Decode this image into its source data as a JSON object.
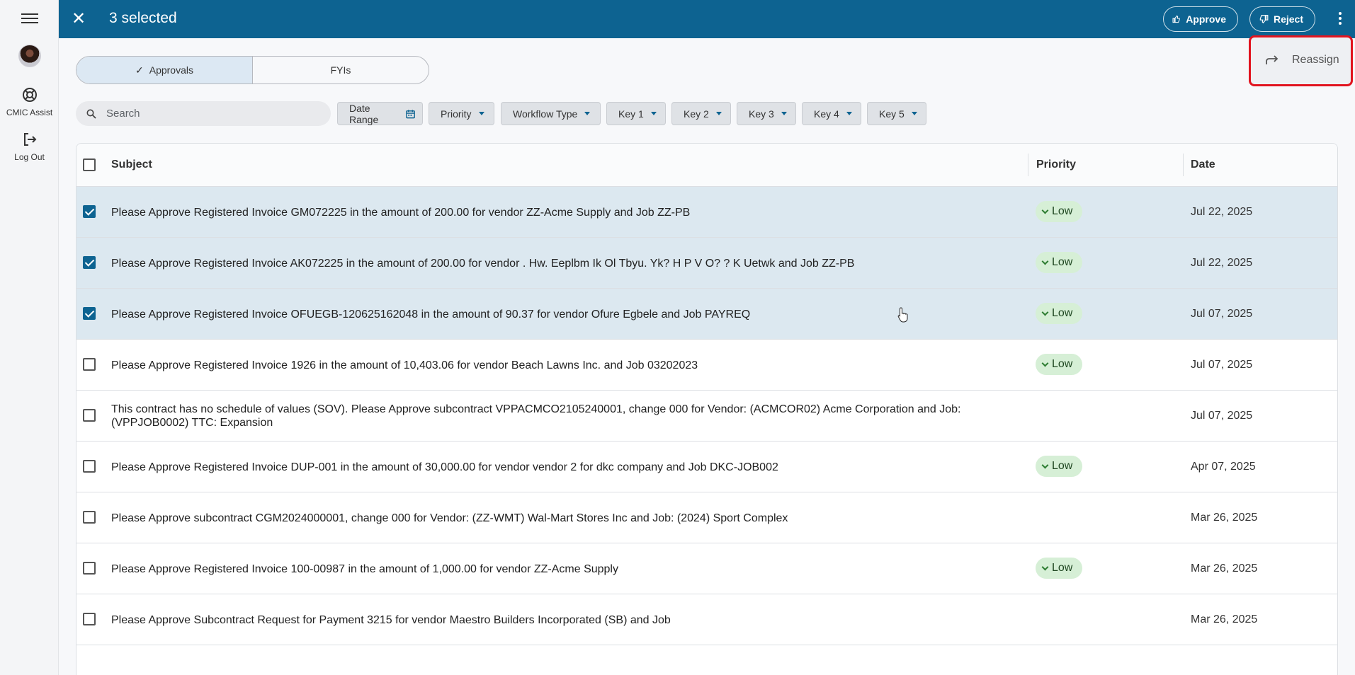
{
  "rail": {
    "assist_label": "CMIC Assist",
    "logout_label": "Log Out"
  },
  "topbar": {
    "title": "3 selected",
    "approve_label": "Approve",
    "reject_label": "Reject",
    "color": "#0d6391"
  },
  "menu": {
    "reassign_label": "Reassign"
  },
  "tabs": [
    {
      "label": "Approvals",
      "active": true
    },
    {
      "label": "FYIs",
      "active": false
    }
  ],
  "search": {
    "placeholder": "Search"
  },
  "filters": [
    "Date Range",
    "Priority",
    "Workflow Type",
    "Key 1",
    "Key 2",
    "Key 3",
    "Key 4",
    "Key 5"
  ],
  "table": {
    "columns": [
      "Subject",
      "Priority",
      "Date"
    ],
    "rows": [
      {
        "checked": true,
        "subject": "Please Approve Registered Invoice GM072225 in the amount of 200.00 for vendor ZZ-Acme Supply and Job ZZ-PB",
        "priority": "Low",
        "date": "Jul 22, 2025"
      },
      {
        "checked": true,
        "subject": "Please Approve Registered Invoice AK072225 in the amount of 200.00 for vendor . Hw. Eeplbm Ik Ol Tbyu. Yk? H P V O? ? K Uetwk and Job ZZ-PB",
        "priority": "Low",
        "date": "Jul 22, 2025"
      },
      {
        "checked": true,
        "subject": "Please Approve Registered Invoice OFUEGB-120625162048 in the amount of 90.37 for vendor Ofure Egbele and Job PAYREQ",
        "priority": "Low",
        "date": "Jul 07, 2025"
      },
      {
        "checked": false,
        "subject": "Please Approve Registered Invoice 1926 in the amount of 10,403.06 for vendor Beach Lawns Inc. and Job 03202023",
        "priority": "Low",
        "date": "Jul 07, 2025"
      },
      {
        "checked": false,
        "subject": "This contract has no schedule of values (SOV). Please Approve subcontract VPPACMCO2105240001, change 000 for Vendor: (ACMCOR02) Acme Corporation and Job: (VPPJOB0002) TTC: Expansion",
        "priority": "",
        "date": "Jul 07, 2025"
      },
      {
        "checked": false,
        "subject": "Please Approve Registered Invoice DUP-001 in the amount of 30,000.00 for vendor vendor 2 for dkc company and Job DKC-JOB002",
        "priority": "Low",
        "date": "Apr 07, 2025"
      },
      {
        "checked": false,
        "subject": "Please Approve subcontract CGM2024000001, change 000 for Vendor: (ZZ-WMT) Wal-Mart Stores Inc and Job: (2024) Sport Complex",
        "priority": "",
        "date": "Mar 26, 2025"
      },
      {
        "checked": false,
        "subject": "Please Approve Registered Invoice 100-00987 in the amount of 1,000.00 for vendor ZZ-Acme Supply",
        "priority": "Low",
        "date": "Mar 26, 2025"
      },
      {
        "checked": false,
        "subject": "Please Approve Subcontract Request for Payment 3215 for vendor Maestro Builders Incorporated (SB) and Job",
        "priority": "",
        "date": "Mar 26, 2025"
      }
    ]
  }
}
